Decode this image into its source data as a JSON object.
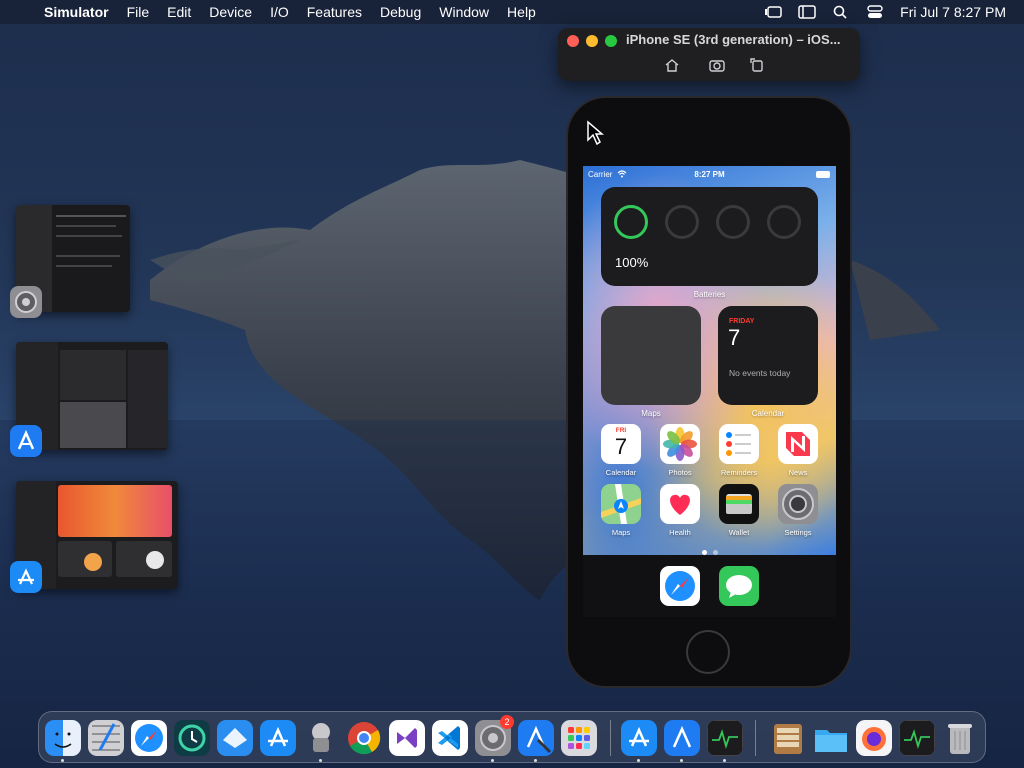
{
  "menubar": {
    "app_name": "Simulator",
    "items": [
      "File",
      "Edit",
      "Device",
      "I/O",
      "Features",
      "Debug",
      "Window",
      "Help"
    ],
    "clock": "Fri Jul 7  8:27 PM"
  },
  "simulator": {
    "title": "iPhone SE (3rd generation) – iOS...",
    "status": {
      "carrier": "Carrier",
      "time": "8:27 PM"
    },
    "batteries_widget": {
      "percent": "100%",
      "label": "Batteries"
    },
    "maps_widget_label": "Maps",
    "calendar_widget": {
      "day": "FRIDAY",
      "date": "7",
      "note": "No events today",
      "label": "Calendar"
    },
    "apps_row1": [
      {
        "label": "Calendar",
        "icon": "calendar-icon",
        "day": "FRI",
        "date": "7"
      },
      {
        "label": "Photos",
        "icon": "photos-icon"
      },
      {
        "label": "Reminders",
        "icon": "reminders-icon"
      },
      {
        "label": "News",
        "icon": "news-icon"
      }
    ],
    "apps_row2": [
      {
        "label": "Maps",
        "icon": "maps-icon"
      },
      {
        "label": "Health",
        "icon": "health-icon"
      },
      {
        "label": "Wallet",
        "icon": "wallet-icon"
      },
      {
        "label": "Settings",
        "icon": "settings-icon"
      }
    ],
    "dock_apps": [
      "safari-icon",
      "messages-icon"
    ]
  },
  "mac_dock": {
    "settings_badge": "2"
  }
}
